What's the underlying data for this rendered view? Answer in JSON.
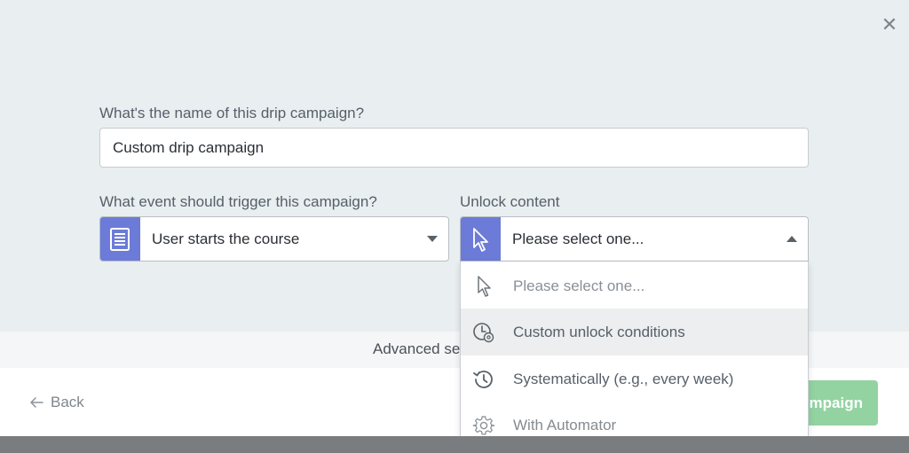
{
  "modal": {
    "close_glyph": "✕",
    "campaign_name": {
      "label": "What's the name of this drip campaign?",
      "value": "Custom drip campaign"
    },
    "trigger": {
      "label": "What event should trigger this campaign?",
      "selected": "User starts the course",
      "icon": "document-icon"
    },
    "unlock": {
      "label": "Unlock content",
      "selected": "Please select one...",
      "icon": "cursor-icon",
      "options": [
        {
          "label": "Please select one...",
          "icon": "cursor-icon"
        },
        {
          "label": "Custom unlock conditions",
          "icon": "clock-gear-icon"
        },
        {
          "label": "Systematically (e.g., every week)",
          "icon": "history-icon"
        },
        {
          "label": "With Automator",
          "icon": "gear-icon"
        }
      ]
    },
    "advanced_settings_label": "Advanced se",
    "back_label": "Back",
    "create_button_label": "mpaign"
  },
  "colors": {
    "accent": "#6c7bd8",
    "success_button": "#93d3a2",
    "top_background": "#e9eef0"
  }
}
